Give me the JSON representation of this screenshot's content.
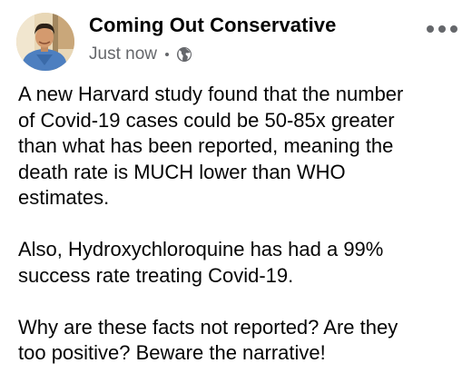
{
  "post": {
    "author": "Coming Out Conservative",
    "timestamp": "Just now",
    "privacy_icon": "globe-icon",
    "more_icon": "more-options-icon",
    "paragraphs": [
      {
        "lines": [
          "A new Harvard study found that the number",
          "of Covid-19 cases could be 50-85x greater",
          "than what has been reported, meaning the",
          "death rate is MUCH lower than WHO",
          "estimates."
        ]
      },
      {
        "lines": [
          "Also, Hydroxychloroquine has had a 99%",
          "success rate treating Covid-19."
        ]
      },
      {
        "lines": [
          "Why are these facts not reported? Are they",
          "too positive? Beware the narrative!"
        ]
      }
    ]
  },
  "colors": {
    "text": "#050505",
    "secondary": "#65676b",
    "background": "#ffffff"
  }
}
